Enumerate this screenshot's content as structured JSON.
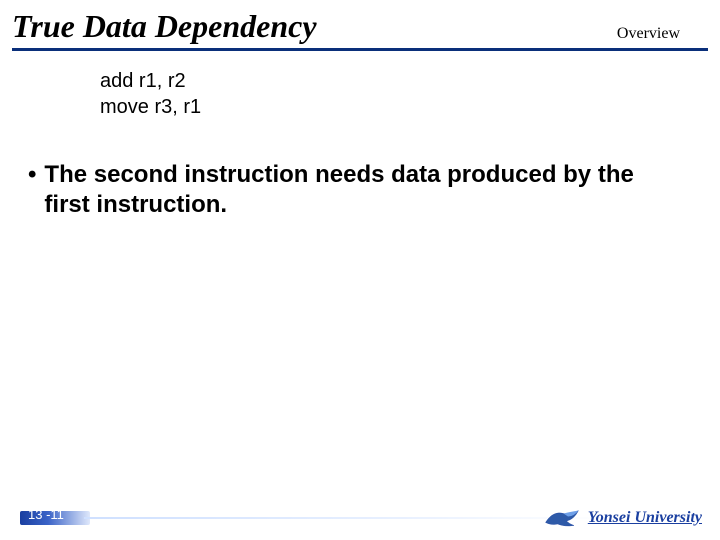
{
  "header": {
    "title": "True Data Dependency",
    "section": "Overview"
  },
  "code": {
    "lines": [
      "add r1, r2",
      "move r3, r1"
    ]
  },
  "bullets": [
    "The second instruction needs data produced by the first instruction."
  ],
  "footer": {
    "page": "13 -11",
    "university": "Yonsei University"
  },
  "colors": {
    "accent": "#0a2f7a",
    "brand": "#1a3fa0"
  }
}
